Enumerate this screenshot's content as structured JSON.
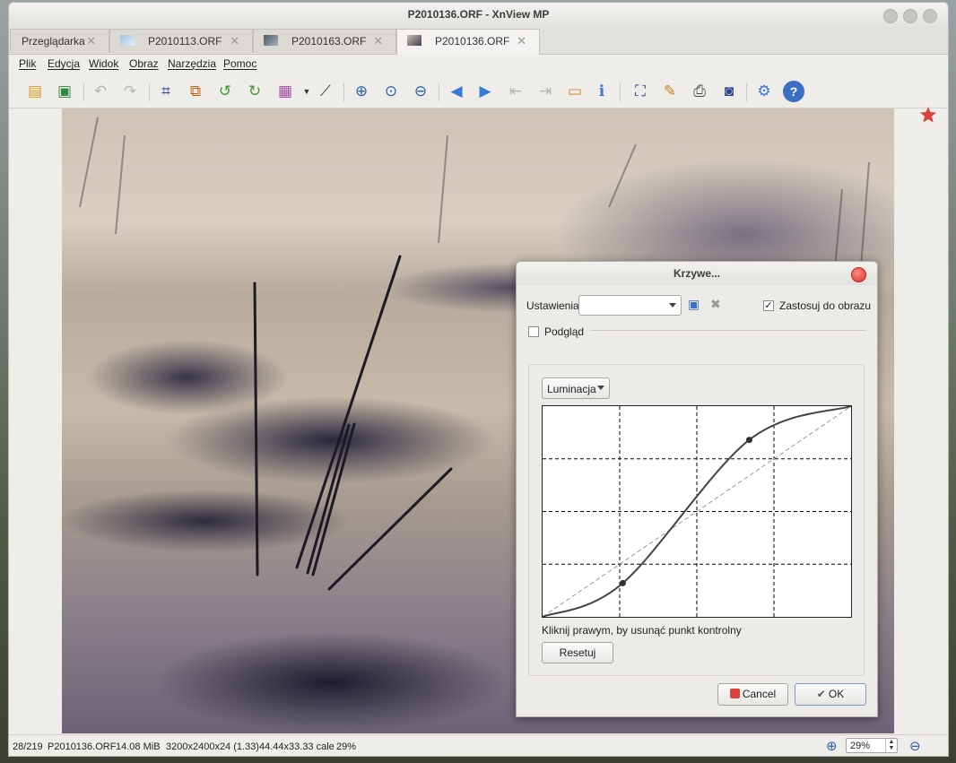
{
  "window": {
    "title": "P2010136.ORF - XnView MP"
  },
  "tabs": [
    {
      "label": "Przeglądarka",
      "close": "✕"
    },
    {
      "label": "P2010113.ORF",
      "close": "✕"
    },
    {
      "label": "P2010163.ORF",
      "close": "✕"
    },
    {
      "label": "P2010136.ORF",
      "close": "✕"
    }
  ],
  "menu": [
    "Plik",
    "Edycja",
    "Widok",
    "Obraz",
    "Narzędzia",
    "Pomoc"
  ],
  "toolbar_icons": [
    "browser-icon",
    "save-icon",
    "undo-icon",
    "redo-icon",
    "crop-icon",
    "resize-icon",
    "rotate-left-icon",
    "rotate-right-icon",
    "color-adjust-icon",
    "curves-icon",
    "zoom-in-icon",
    "zoom-actual-icon",
    "zoom-out-icon",
    "previous-icon",
    "next-icon",
    "first-icon",
    "last-icon",
    "slideshow-icon",
    "info-icon",
    "fullscreen-icon",
    "edit-text-icon",
    "print-icon",
    "capture-icon",
    "settings-icon",
    "help-icon"
  ],
  "status": {
    "index": "28/219",
    "filename": "P2010136.ORF",
    "filesize": "14.08 MiB",
    "dimensions": "3200x2400x24 (1.33)",
    "print_size": "44.44x33.33 cale",
    "zoom": "29%",
    "zoom_value": "29%"
  },
  "dialog": {
    "title": "Krzywe...",
    "settings_label": "Ustawienia:",
    "settings_value": "",
    "apply_label": "Zastosuj do obrazu",
    "apply_checked": true,
    "preview_label": "Podgląd",
    "preview_checked": false,
    "channel": "Luminacja",
    "hint": "Kliknij prawym, by usunąć punkt kontrolny",
    "reset_label": "Resetuj",
    "cancel_label": "Cancel",
    "ok_label": "OK"
  },
  "curve": {
    "control_points": [
      [
        0,
        0
      ],
      [
        0.26,
        0.16
      ],
      [
        0.67,
        0.84
      ],
      [
        1,
        1
      ]
    ]
  },
  "colors": {
    "accent": "#3b6fc6",
    "close_red": "#e0342a"
  }
}
